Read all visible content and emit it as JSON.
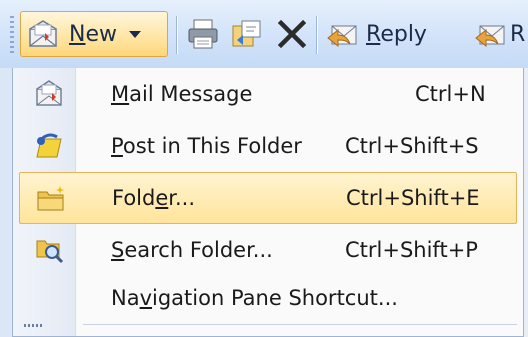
{
  "toolbar": {
    "new_label_pre": "",
    "new_label_accel": "N",
    "new_label_post": "ew",
    "reply_label_accel": "R",
    "reply_label_post": "eply",
    "cut_off_label": "R"
  },
  "menu": {
    "items": [
      {
        "accel": "M",
        "rest": "ail Message",
        "pre": "",
        "shortcut": "Ctrl+N",
        "icon": "mail-message-icon"
      },
      {
        "accel": "P",
        "rest": "ost in This Folder",
        "pre": "",
        "shortcut": "Ctrl+Shift+S",
        "icon": "post-icon"
      },
      {
        "pre": "Fold",
        "accel": "e",
        "rest": "r...",
        "shortcut": "Ctrl+Shift+E",
        "icon": "folder-icon",
        "highlighted": true
      },
      {
        "accel": "S",
        "rest": "earch Folder...",
        "pre": "",
        "shortcut": "Ctrl+Shift+P",
        "icon": "search-folder-icon"
      },
      {
        "pre": "Na",
        "accel": "v",
        "rest": "igation Pane Shortcut...",
        "shortcut": "",
        "icon": ""
      }
    ]
  },
  "colors": {
    "highlight": "#ffe49a",
    "toolbar": "#d5e5fa",
    "text": "#1a1a1a"
  }
}
